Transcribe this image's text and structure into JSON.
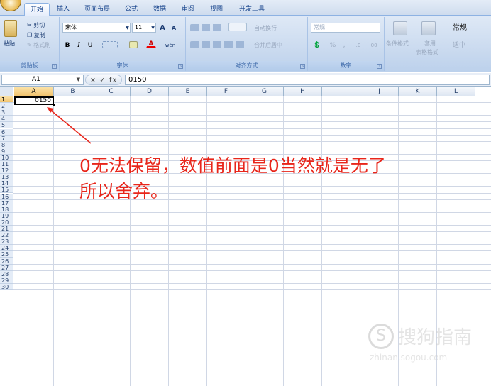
{
  "tabs": [
    "开始",
    "插入",
    "页面布局",
    "公式",
    "数据",
    "审阅",
    "视图",
    "开发工具"
  ],
  "ribbon": {
    "clipboard": {
      "paste": "粘贴",
      "cut": "剪切",
      "copy": "复制",
      "format_painter": "格式刷",
      "label": "剪贴板"
    },
    "font": {
      "name": "宋体",
      "size": "11",
      "grow": "A",
      "shrink": "A",
      "bold": "B",
      "italic": "I",
      "underline": "U",
      "font_color": "A",
      "phonetic": "wén",
      "label": "字体"
    },
    "alignment": {
      "wrap_text": "自动换行",
      "merge_center": "合并后居中",
      "label": "对齐方式"
    },
    "number": {
      "format": "常规",
      "percent": "%",
      "comma": ",",
      "increase_decimal": ".0",
      "decrease_decimal": ".00",
      "label": "数字"
    },
    "styles": {
      "conditional": "条件格式",
      "table": "套用",
      "table_format": "表格格式",
      "cell_style_value": "常规",
      "cell_style_value2": "适中"
    }
  },
  "formula_bar": {
    "name_box": "A1",
    "fx": "× ✓ fx",
    "value": "0150"
  },
  "columns": [
    "A",
    "B",
    "C",
    "D",
    "E",
    "F",
    "G",
    "H",
    "I",
    "J",
    "K",
    "L"
  ],
  "rows": [
    "1",
    "2",
    "3",
    "4",
    "5",
    "6",
    "7",
    "8",
    "9",
    "10",
    "11",
    "12",
    "13",
    "14",
    "15",
    "16",
    "17",
    "18",
    "19",
    "20",
    "21",
    "22",
    "23",
    "24",
    "25",
    "26",
    "27",
    "28",
    "29",
    "30"
  ],
  "cell_a1": "0150",
  "annotation": {
    "line1": "0无法保留，数值前面是0当然就是无了",
    "line2": "所以舍弃。"
  },
  "watermark": {
    "text": "搜狗指南",
    "url": "zhinan.sogou.com",
    "logo": "S"
  },
  "colors": {
    "annotation": "#e8261b",
    "selected_header": "#f2c46f"
  }
}
